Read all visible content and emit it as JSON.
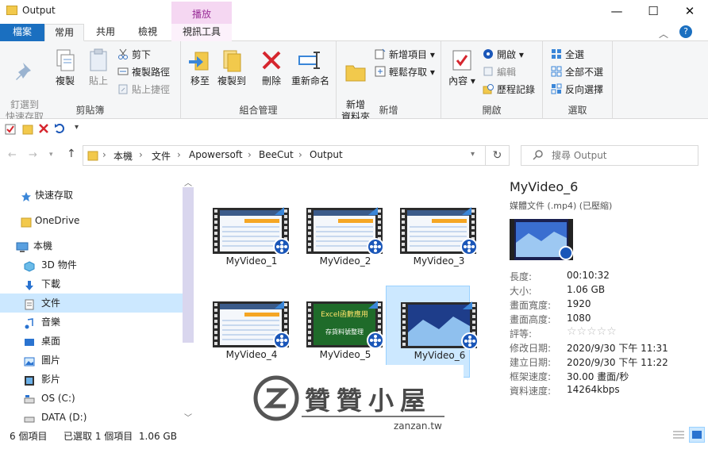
{
  "window": {
    "title": "Output",
    "minimize_glyph": "—",
    "maximize_glyph": "☐",
    "close_glyph": "✕"
  },
  "ribbon": {
    "context_header": "播放",
    "tabs": [
      "檔案",
      "常用",
      "共用",
      "檢視",
      "視訊工具"
    ],
    "groups": {
      "clipboard": {
        "label": "剪貼簿",
        "pin": "釘選到\n快速存取",
        "copy": "複製",
        "paste": "貼上",
        "cut": "剪下",
        "copy_path": "複製路徑",
        "paste_shortcut": "貼上捷徑"
      },
      "organize": {
        "label": "組合管理",
        "move_to": "移至",
        "copy_to": "複製到",
        "delete": "刪除",
        "rename": "重新命名"
      },
      "new": {
        "label": "新增",
        "new_folder": "新增\n資料夾",
        "new_item": "新增項目",
        "easy_access": "輕鬆存取"
      },
      "open": {
        "label": "開啟",
        "properties": "內容",
        "open": "開啟",
        "edit": "編輯",
        "history": "歷程記錄"
      },
      "select": {
        "label": "選取",
        "select_all": "全選",
        "select_none": "全部不選",
        "invert": "反向選擇"
      }
    }
  },
  "address": {
    "crumbs": [
      "本機",
      "文件",
      "Apowersoft",
      "BeeCut",
      "Output"
    ],
    "search_placeholder": "搜尋 Output"
  },
  "nav": {
    "items": [
      {
        "label": "快速存取",
        "icon": "star-icon"
      },
      {
        "label": "OneDrive",
        "icon": "folder-icon"
      },
      {
        "label": "本機",
        "icon": "computer-icon"
      },
      {
        "label": "3D 物件",
        "icon": "cube-icon"
      },
      {
        "label": "下載",
        "icon": "download-icon"
      },
      {
        "label": "文件",
        "icon": "document-icon"
      },
      {
        "label": "音樂",
        "icon": "music-icon"
      },
      {
        "label": "桌面",
        "icon": "desktop-icon"
      },
      {
        "label": "圖片",
        "icon": "picture-icon"
      },
      {
        "label": "影片",
        "icon": "video-icon"
      },
      {
        "label": "OS (C:)",
        "icon": "drive-icon"
      },
      {
        "label": "DATA (D:)",
        "icon": "drive-icon"
      }
    ]
  },
  "files": [
    {
      "name": "MyVideo_1",
      "variant": "table"
    },
    {
      "name": "MyVideo_2",
      "variant": "table"
    },
    {
      "name": "MyVideo_3",
      "variant": "table"
    },
    {
      "name": "MyVideo_4",
      "variant": "table"
    },
    {
      "name": "MyVideo_5",
      "variant": "green",
      "thumb_line1": "Excel函數應用",
      "thumb_line2": "存貨料號整理"
    },
    {
      "name": "MyVideo_6",
      "variant": "video",
      "selected": true
    }
  ],
  "details": {
    "title": "MyVideo_6",
    "type": "媒體文件 (.mp4) (已壓縮)",
    "rows": [
      {
        "key": "長度:",
        "value": "00:10:32"
      },
      {
        "key": "大小:",
        "value": "1.06 GB"
      },
      {
        "key": "畫面寬度:",
        "value": "1920"
      },
      {
        "key": "畫面高度:",
        "value": "1080"
      },
      {
        "key": "評等:",
        "value": "☆☆☆☆☆"
      },
      {
        "key": "修改日期:",
        "value": "2020/9/30 下午 11:31"
      },
      {
        "key": "建立日期:",
        "value": "2020/9/30 下午 11:22"
      },
      {
        "key": "框架速度:",
        "value": "30.00 畫面/秒"
      },
      {
        "key": "資料速度:",
        "value": "14264kbps"
      }
    ]
  },
  "status": {
    "count": "6 個項目",
    "selected": "已選取 1 個項目  1.06 GB"
  },
  "watermark": {
    "title": "贊贊小屋",
    "url": "zanzan.tw"
  },
  "colors": {
    "accent": "#1a6fc0",
    "context_tab": "#f5d7f2",
    "selection": "#cce8ff"
  }
}
